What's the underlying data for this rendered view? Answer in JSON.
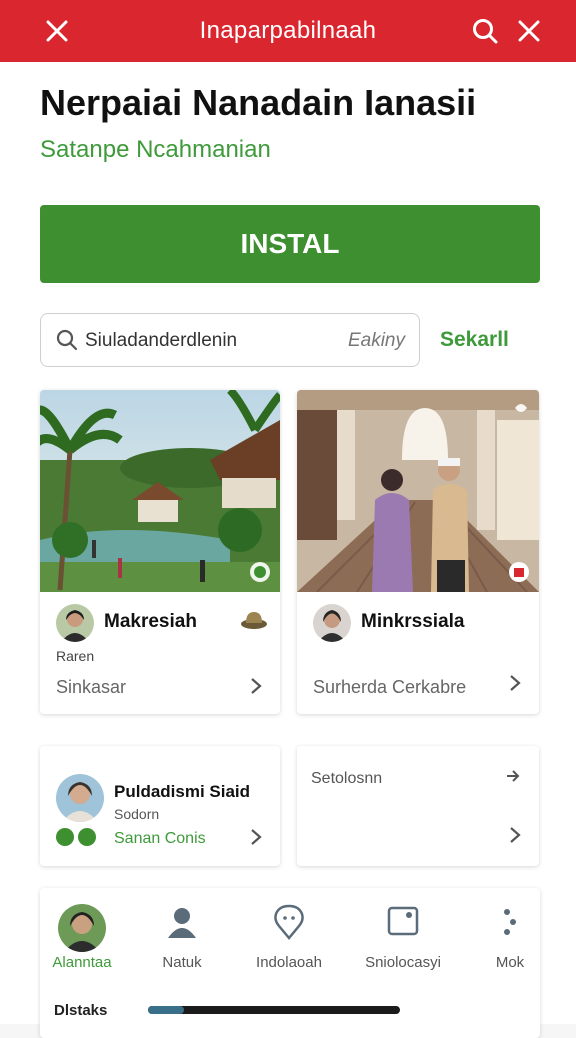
{
  "header": {
    "title": "Inaparpabilnaah",
    "left_icon": "close-icon",
    "right_icons": [
      "search-icon",
      "close-icon"
    ],
    "color": "#d9262f"
  },
  "app": {
    "title": "Nerpaiai Nanadain Ianasii",
    "subtitle": "Satanpe Ncahmanian",
    "install_label": "INSTAL",
    "accent": "#3d8f2f"
  },
  "search": {
    "value": "Siuladanderdlenin",
    "hint": "Eakiny",
    "see_all": "Sekarll"
  },
  "cards": [
    {
      "name": "Makresiah",
      "small": "Raren",
      "footer": "Sinkasar",
      "badge_icon": "hat-icon",
      "overlay_icon": "shield-icon"
    },
    {
      "name": "Minkrssiala",
      "footer": "Surherda Cerkabre",
      "overlay_icon": "heart-icon",
      "badge_icon": "gift-icon"
    }
  ],
  "small_cards": [
    {
      "name": "Puldadismi Siaid",
      "sub": "Sodorn",
      "status": "Sanan Conis"
    },
    {
      "label": "Setolosnn"
    }
  ],
  "nav": {
    "items": [
      {
        "label": "Alanntaa",
        "icon": "avatar-icon",
        "active": true
      },
      {
        "label": "Natuk",
        "icon": "person-icon",
        "active": false
      },
      {
        "label": "Indolaoah",
        "icon": "location-icon",
        "active": false
      },
      {
        "label": "Sniolocasyi",
        "icon": "camera-icon",
        "active": false
      },
      {
        "label": "Mok",
        "icon": "more-icon",
        "active": false
      }
    ],
    "footer_tab": "Dlstaks"
  }
}
